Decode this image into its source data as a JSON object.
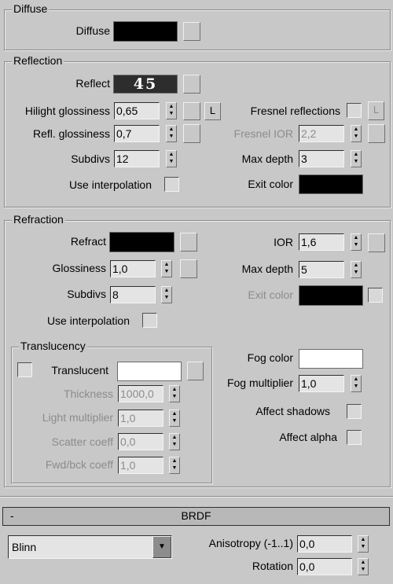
{
  "diffuse": {
    "group": "Diffuse",
    "label": "Diffuse",
    "color": "#000000"
  },
  "reflection": {
    "group": "Reflection",
    "reflect_label": "Reflect",
    "reflect_value": "45",
    "reflect_color": "#2d2d2d",
    "hilight_label": "Hilight glossiness",
    "hilight_value": "0,65",
    "lock_label": "L",
    "fresnel_label": "Fresnel reflections",
    "fresnel_checked": false,
    "fresnel_lock_label": "L",
    "refl_gloss_label": "Refl. glossiness",
    "refl_gloss_value": "0,7",
    "fresnel_ior_label": "Fresnel IOR",
    "fresnel_ior_value": "2,2",
    "subdivs_label": "Subdivs",
    "subdivs_value": "12",
    "max_depth_label": "Max depth",
    "max_depth_value": "3",
    "interp_label": "Use interpolation",
    "interp_checked": false,
    "exit_label": "Exit color",
    "exit_color": "#000000"
  },
  "refraction": {
    "group": "Refraction",
    "refract_label": "Refract",
    "refract_color": "#000000",
    "ior_label": "IOR",
    "ior_value": "1,6",
    "gloss_label": "Glossiness",
    "gloss_value": "1,0",
    "max_depth_label": "Max depth",
    "max_depth_value": "5",
    "subdivs_label": "Subdivs",
    "subdivs_value": "8",
    "exit_label": "Exit color",
    "exit_color": "#000000",
    "exit_checked": false,
    "interp_label": "Use interpolation",
    "interp_checked": false,
    "fog_color_label": "Fog color",
    "fog_color": "#ffffff",
    "fog_mult_label": "Fog multiplier",
    "fog_mult_value": "1,0",
    "affect_shadows_label": "Affect shadows",
    "affect_shadows_checked": false,
    "affect_alpha_label": "Affect alpha",
    "affect_alpha_checked": false,
    "translucency": {
      "group": "Translucency",
      "translucent_label": "Translucent",
      "translucent_checked": false,
      "color": "#ffffff",
      "thickness_label": "Thickness",
      "thickness_value": "1000,0",
      "light_mult_label": "Light multiplier",
      "light_mult_value": "1,0",
      "scatter_label": "Scatter coeff",
      "scatter_value": "0,0",
      "fwd_label": "Fwd/bck coeff",
      "fwd_value": "1,0"
    }
  },
  "brdf": {
    "collapse_label": "-",
    "title": "BRDF",
    "type_value": "Blinn",
    "anisotropy_label": "Anisotropy (-1..1)",
    "anisotropy_value": "0,0",
    "rotation_label": "Rotation",
    "rotation_value": "0,0"
  }
}
